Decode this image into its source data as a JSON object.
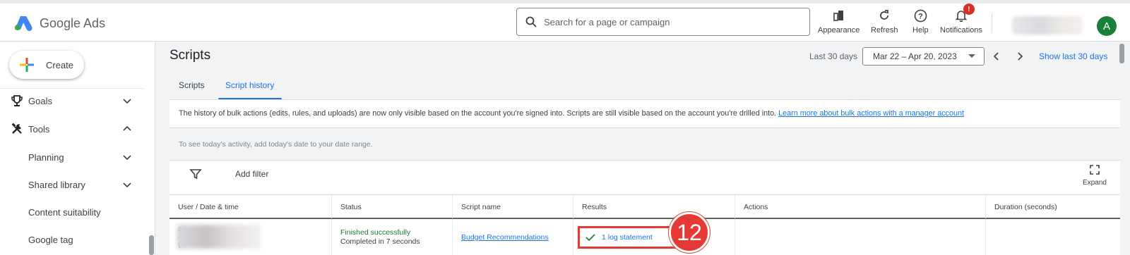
{
  "app": {
    "name": "Google Ads"
  },
  "search": {
    "placeholder": "Search for a page or campaign"
  },
  "toolbar": {
    "appearance": "Appearance",
    "refresh": "Refresh",
    "help": "Help",
    "notifications": "Notifications",
    "notification_badge": "!"
  },
  "account": {
    "avatar_letter": "A"
  },
  "sidebar": {
    "create_label": "Create",
    "items": [
      {
        "label": "Goals",
        "icon": "trophy-icon",
        "expanded": false
      },
      {
        "label": "Tools",
        "icon": "tools-icon",
        "expanded": true
      },
      {
        "label": "Planning",
        "expanded": false
      },
      {
        "label": "Shared library",
        "expanded": false
      },
      {
        "label": "Content suitability"
      },
      {
        "label": "Google tag"
      }
    ]
  },
  "page": {
    "title": "Scripts",
    "date_label": "Last 30 days",
    "date_range": "Mar 22 – Apr 20, 2023",
    "show_last": "Show last 30 days"
  },
  "tabs": [
    {
      "label": "Scripts",
      "active": false
    },
    {
      "label": "Script history",
      "active": true
    }
  ],
  "notice": {
    "text": "The history of bulk actions (edits, rules, and uploads) are now only visible based on the account you're signed into. Scripts are still visible based on the account you're drilled into.",
    "link": "Learn more about bulk actions with a manager account"
  },
  "hint": "To see today's activity, add today's date to your date range.",
  "table": {
    "add_filter": "Add filter",
    "expand": "Expand",
    "columns": [
      "User / Date & time",
      "Status",
      "Script name",
      "Results",
      "Actions",
      "Duration (seconds)"
    ],
    "rows": [
      {
        "user_line1": "a",
        "user_line2": "A",
        "user_line3": "(",
        "status": "Finished successfully",
        "status_detail": "Completed in 7 seconds",
        "script_name": "Budget Recommendations",
        "result": "1 log statement",
        "actions": "",
        "duration": ""
      }
    ]
  },
  "annotation": {
    "step_number": "12"
  },
  "colors": {
    "accent": "#1a73e8",
    "success": "#188038",
    "annotation": "#e53935",
    "avatar": "#188038"
  }
}
